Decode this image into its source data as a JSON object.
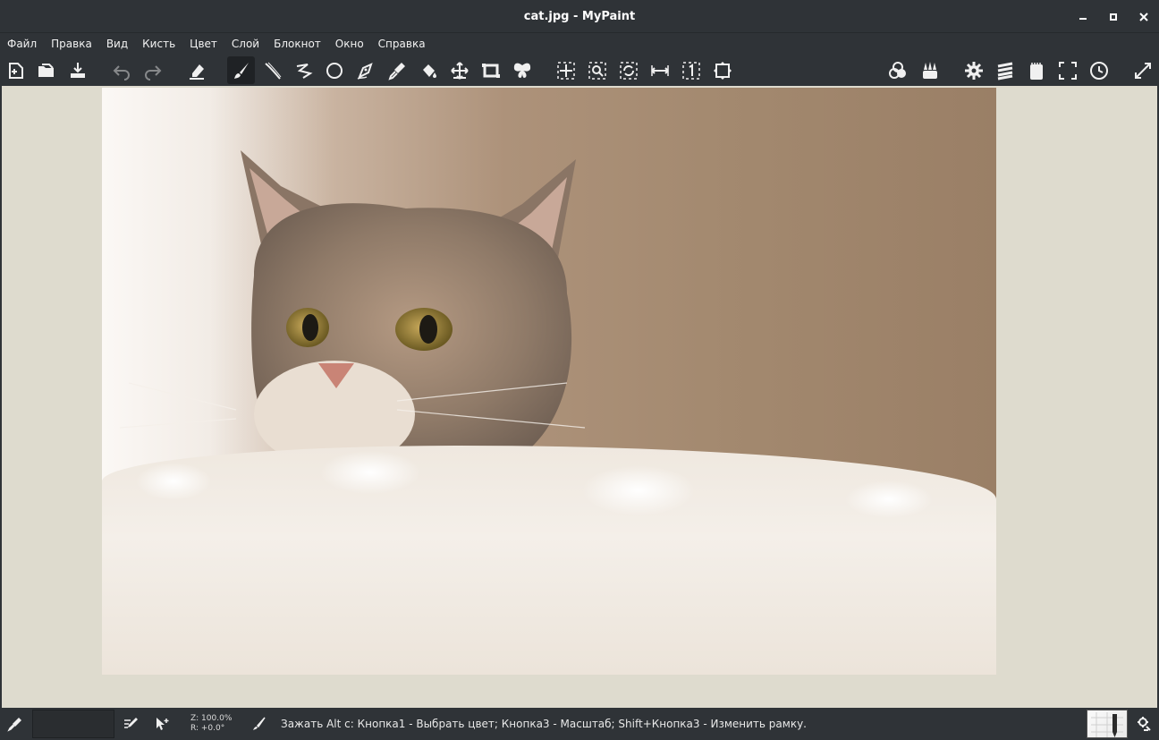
{
  "window": {
    "title": "cat.jpg - MyPaint",
    "controls": [
      "minimize-icon",
      "maximize-icon",
      "close-icon"
    ]
  },
  "menu": {
    "items": [
      "Файл",
      "Правка",
      "Вид",
      "Кисть",
      "Цвет",
      "Слой",
      "Блокнот",
      "Окно",
      "Справка"
    ]
  },
  "toolbar": {
    "file_tools": [
      "new-document-icon",
      "open-file-icon",
      "save-file-icon"
    ],
    "edit_tools": [
      "undo-icon",
      "redo-icon"
    ],
    "erase_tool": "eraser-icon",
    "paint_tools": [
      "freehand-brush-icon",
      "inking-line-icon",
      "connected-lines-icon",
      "ellipse-icon",
      "pen-curve-icon",
      "color-picker-icon",
      "flood-fill-icon",
      "layer-move-icon",
      "frame-icon",
      "symmetry-icon"
    ],
    "view_tools": [
      "pan-view-icon",
      "zoom-view-icon",
      "rotate-view-icon",
      "mirror-view-icon",
      "reset-view-icon",
      "fit-view-icon"
    ],
    "panel_tools": [
      "color-panels-icon",
      "brush-panels-icon",
      "preferences-icon",
      "layers-icon",
      "scratchpad-icon",
      "fullscreen-icon",
      "history-icon",
      "expand-icon"
    ],
    "active_tool": "freehand-brush-icon"
  },
  "document": {
    "image_description_icon": "cat-photo"
  },
  "statusbar": {
    "zoom_line": "Z: 100.0%",
    "rotation_line": "R: +0.0°",
    "message": "Зажать Alt с:  Кнопка1 - Выбрать цвет;  Кнопка3 - Масштаб;  Shift+Кнопка3 - Изменить рамку.",
    "current_color": "#2a2d30"
  },
  "colors": {
    "chrome": "#2f3337",
    "canvas_bg": "#dedbce",
    "icon": "#f0f0f0"
  }
}
